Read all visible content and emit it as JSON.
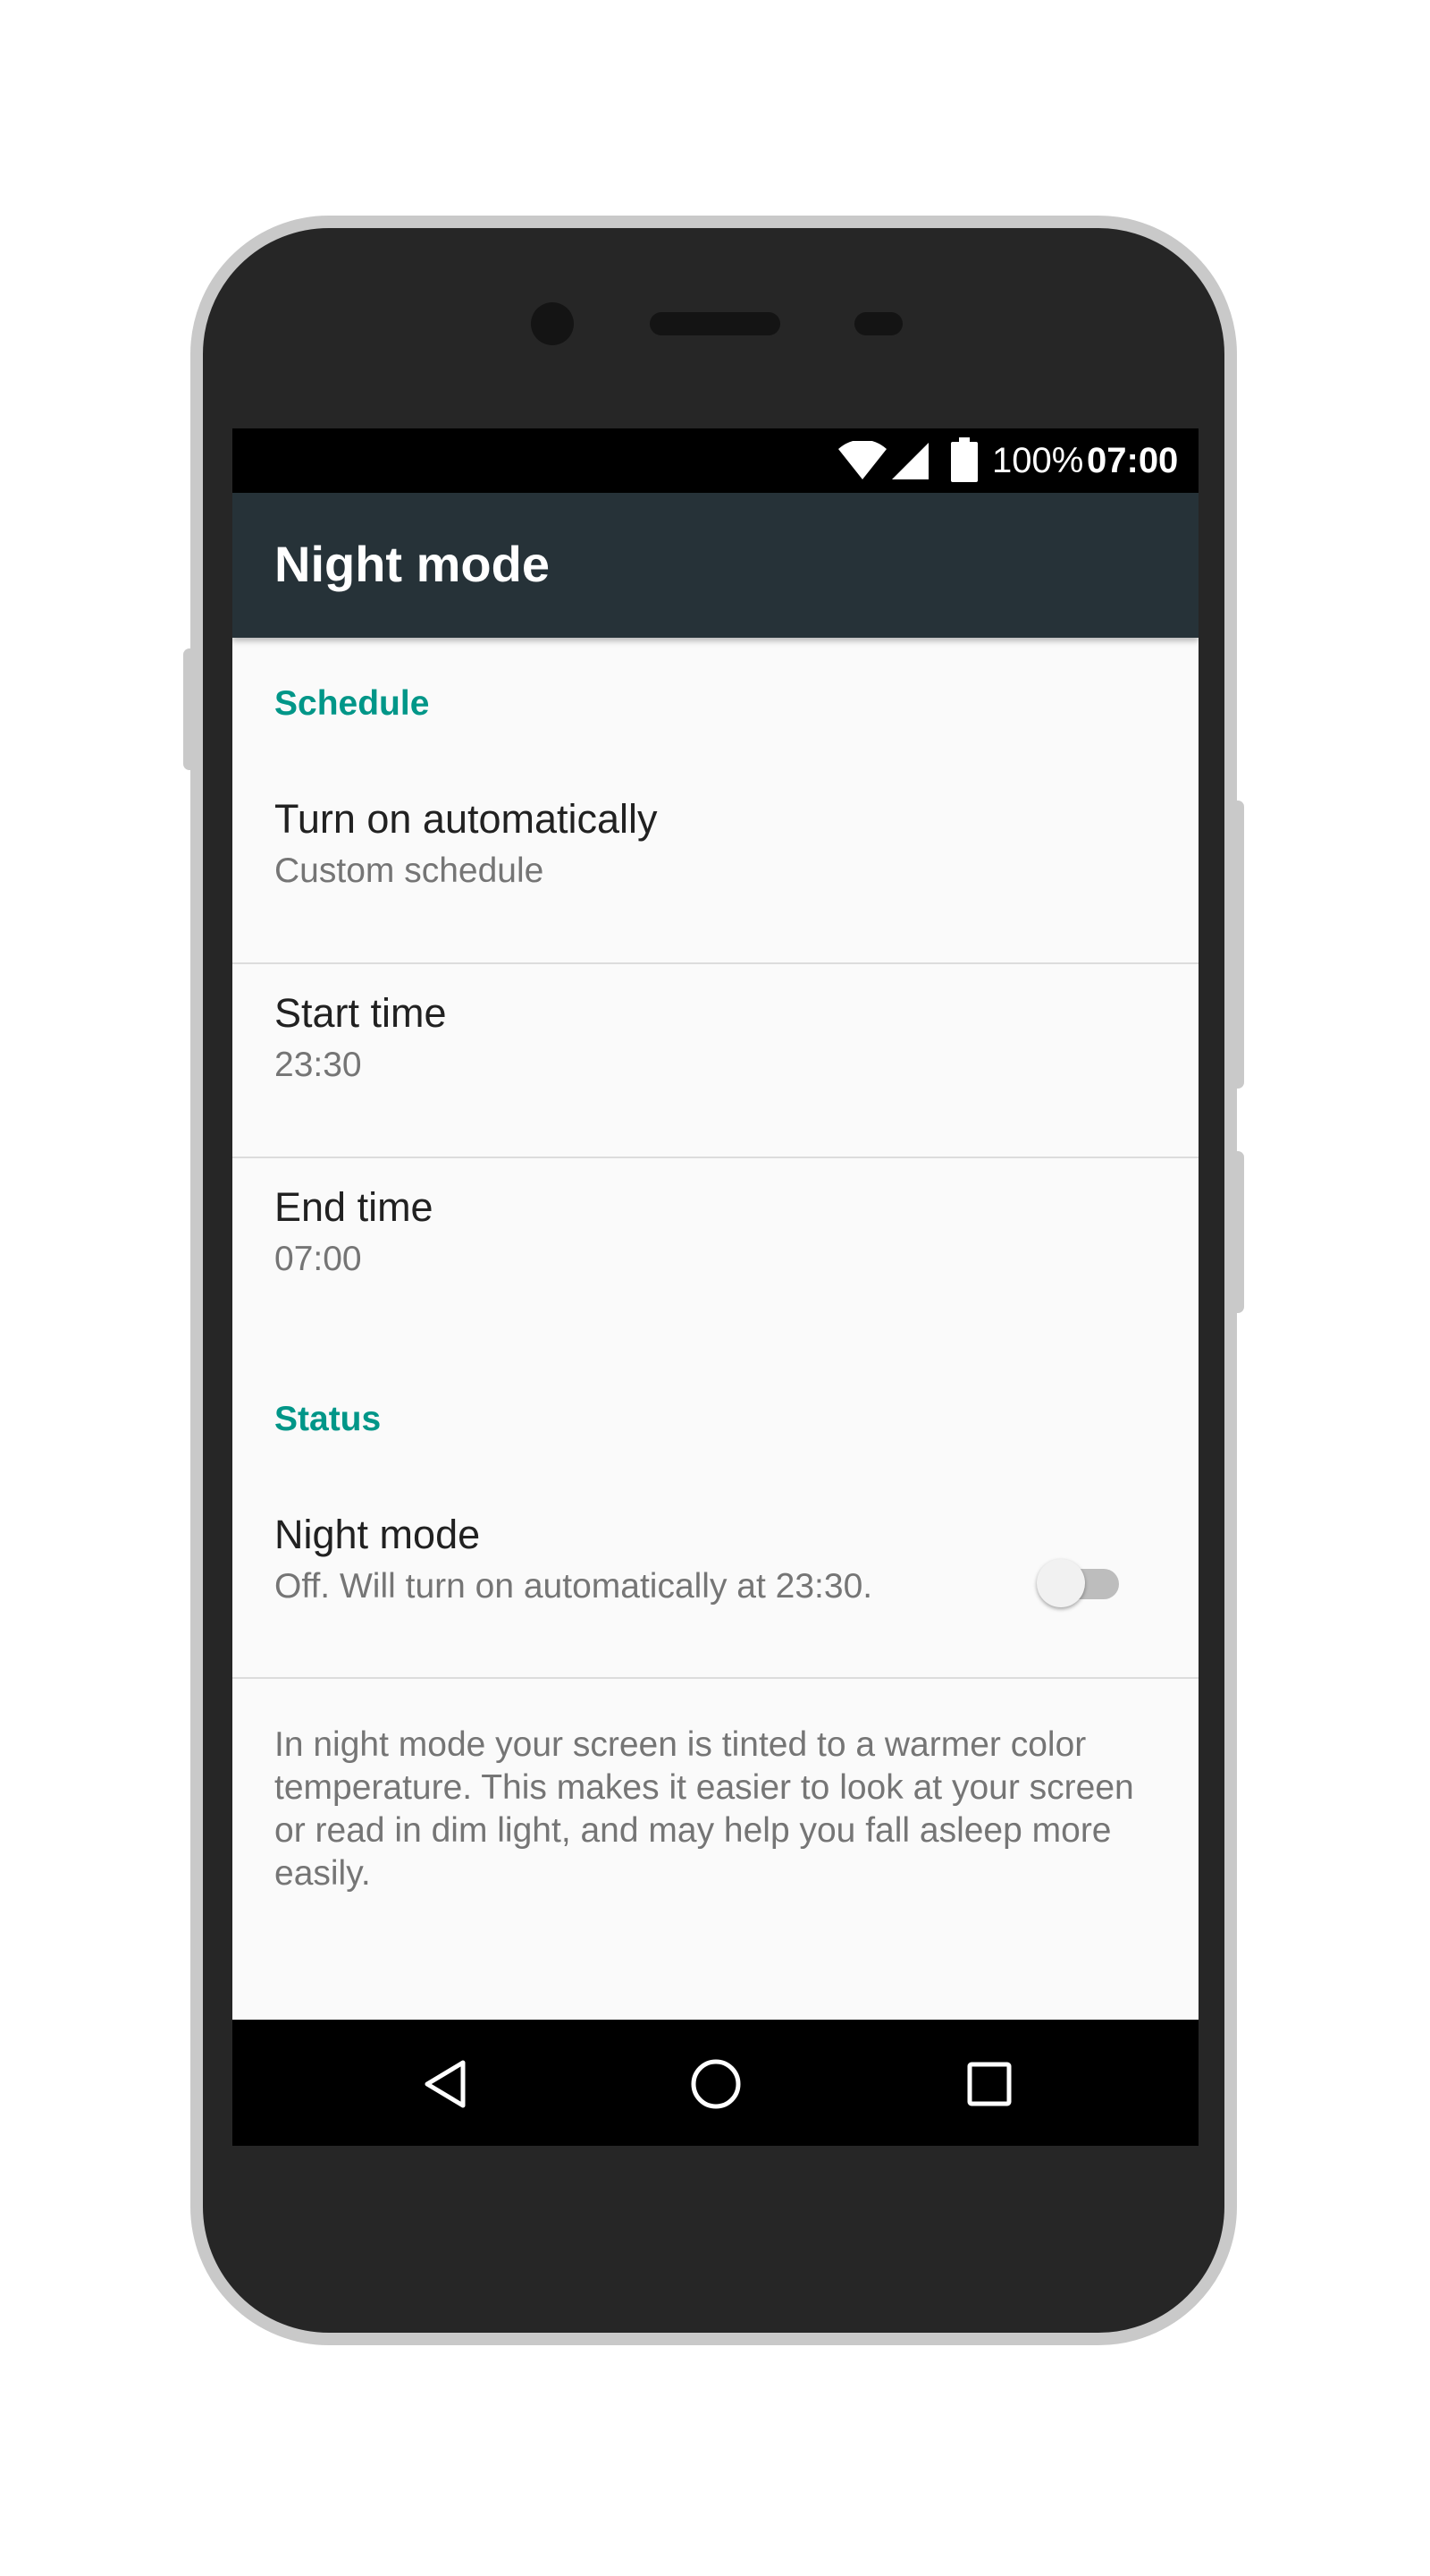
{
  "status_bar": {
    "battery_percent": "100%",
    "time": "07:00",
    "icons": [
      "wifi-icon",
      "signal-icon",
      "battery-icon"
    ]
  },
  "app_bar": {
    "title": "Night mode"
  },
  "sections": {
    "schedule_header": "Schedule",
    "status_header": "Status"
  },
  "items": {
    "turn_on": {
      "title": "Turn on automatically",
      "summary": "Custom schedule"
    },
    "start_time": {
      "title": "Start time",
      "summary": "23:30"
    },
    "end_time": {
      "title": "End time",
      "summary": "07:00"
    },
    "night_mode": {
      "title": "Night mode",
      "summary": "Off. Will turn on automatically at 23:30.",
      "enabled": false
    }
  },
  "footer": {
    "text": "In night mode your screen is tinted to a warmer color temperature. This makes it easier to look at your screen or read in dim light, and may help you fall asleep more easily."
  },
  "nav_bar": {
    "buttons": [
      "back-icon",
      "home-icon",
      "recents-icon"
    ]
  },
  "colors": {
    "app_bar": "#263238",
    "accent": "#009688",
    "background": "#fafafa",
    "phone_body": "#262626",
    "phone_frame": "#c9c9c9"
  }
}
